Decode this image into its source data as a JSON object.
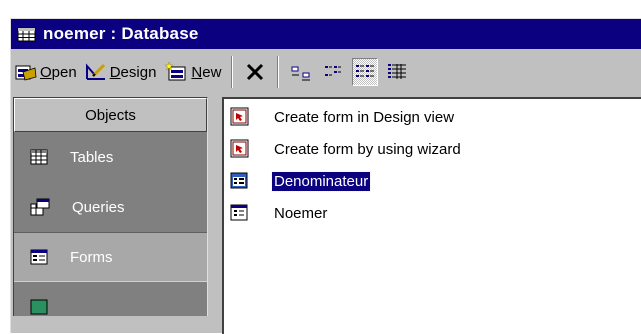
{
  "window": {
    "title": "noemer : Database"
  },
  "toolbar": {
    "open_label_key": "O",
    "open_label_rest": "pen",
    "design_label_key": "D",
    "design_label_rest": "esign",
    "new_label_key": "N",
    "new_label_rest": "ew"
  },
  "sidebar": {
    "header": "Objects",
    "items": [
      {
        "label": "Tables",
        "icon": "table-icon"
      },
      {
        "label": "Queries",
        "icon": "query-icon"
      },
      {
        "label": "Forms",
        "icon": "form-icon",
        "active": true
      }
    ]
  },
  "list": {
    "items": [
      {
        "label": "Create form in Design view",
        "icon": "shortcut-icon"
      },
      {
        "label": "Create form by using wizard",
        "icon": "shortcut-icon"
      },
      {
        "label": "Denominateur",
        "icon": "form-icon",
        "selected": true
      },
      {
        "label": "Noemer",
        "icon": "form-icon"
      }
    ]
  },
  "colors": {
    "titlebar": "#0a0080",
    "selection": "#0a0080",
    "face": "#c0c0c0",
    "sidebar_bg": "#808080"
  }
}
